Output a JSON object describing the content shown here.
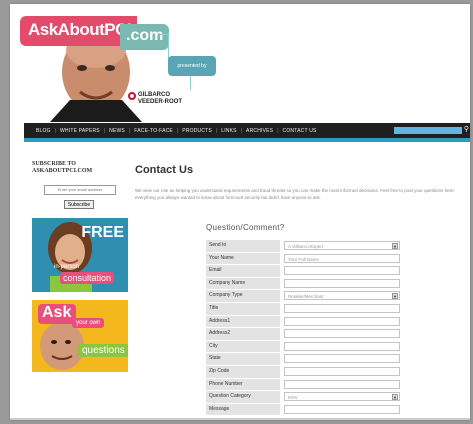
{
  "header": {
    "logo_main": "AskAboutPCI",
    "logo_com": ".com",
    "presented_by": "presented by",
    "sponsor_line1": "GILBARCO",
    "sponsor_line2": "VEEDER-ROOT"
  },
  "nav": {
    "items": [
      "BLOG",
      "WHITE PAPERS",
      "NEWS",
      "FACE-TO-FACE",
      "PRODUCTS",
      "LINKS",
      "ARCHIVES",
      "CONTACT US"
    ]
  },
  "sidebar": {
    "subscribe_title_line1": "SUBSCRIBE TO",
    "subscribe_title_line2": "ASKABOUTPCI.COM",
    "email_placeholder": "Enter your email address",
    "subscribe_button": "Subscribe",
    "ad1": {
      "free": "FREE",
      "in_person": "in-person",
      "consultation": "consultation"
    },
    "ad2": {
      "ask": "Ask",
      "your_own": "your own",
      "questions": "questions"
    }
  },
  "main": {
    "title": "Contact Us",
    "intro": "We view our role as helping you understand requirements and fraud threats so you can make the most informed decisions. Feel free to post your questions here: everything you always wanted to know about forecourt security but didn't have anyone to ask.",
    "form_title": "Question/Comment?",
    "fields": [
      {
        "label": "Send to",
        "value": "A Gilbarco Expert",
        "type": "select"
      },
      {
        "label": "Your Name",
        "value": "Your Full Name",
        "type": "text"
      },
      {
        "label": "Email",
        "value": "",
        "type": "text"
      },
      {
        "label": "Company Name",
        "value": "",
        "type": "text"
      },
      {
        "label": "Company Type",
        "value": "Retailer/Merchant",
        "type": "select"
      },
      {
        "label": "Title",
        "value": "",
        "type": "text"
      },
      {
        "label": "Address1",
        "value": "",
        "type": "text"
      },
      {
        "label": "Address2",
        "value": "",
        "type": "text"
      },
      {
        "label": "City",
        "value": "",
        "type": "text"
      },
      {
        "label": "State",
        "value": "",
        "type": "text"
      },
      {
        "label": "Zip Code",
        "value": "",
        "type": "text"
      },
      {
        "label": "Phone Number",
        "value": "",
        "type": "text"
      },
      {
        "label": "Question Category",
        "value": "EMV",
        "type": "select"
      },
      {
        "label": "Message",
        "value": "",
        "type": "text"
      }
    ]
  },
  "colors": {
    "logo_pink": "#e24b6a",
    "logo_teal": "#7bb8b2",
    "nav_bg": "#1f1f1f",
    "accent_teal": "#2a9bbd",
    "ad_orange": "#f0a21a"
  }
}
